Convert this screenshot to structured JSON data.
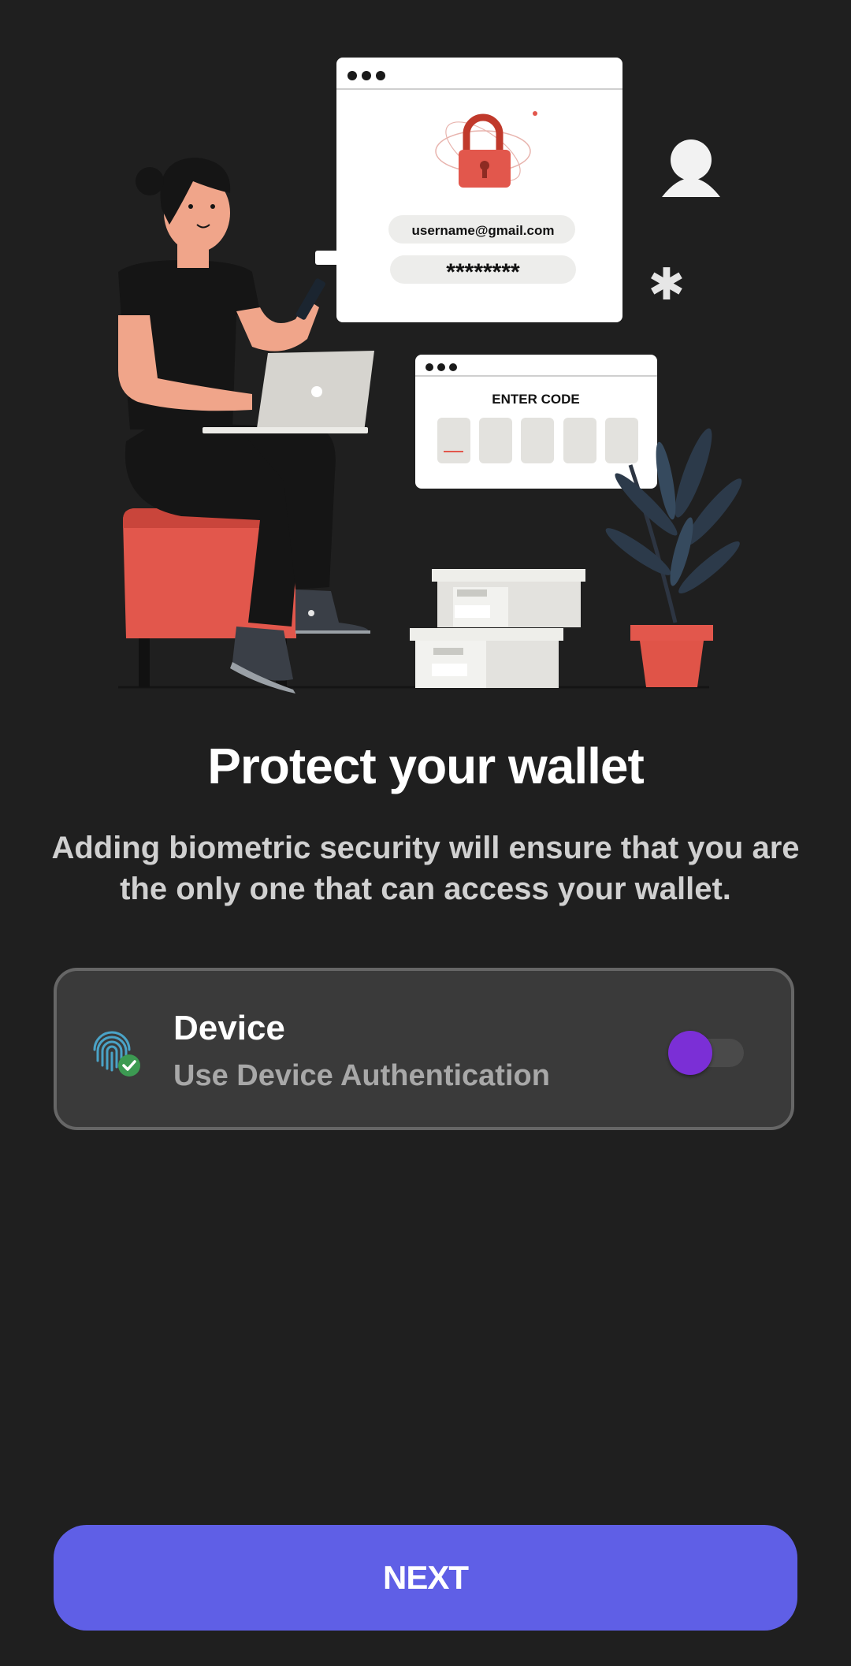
{
  "illustration": {
    "email_text": "username@gmail.com",
    "password_text": "********",
    "code_label": "ENTER CODE"
  },
  "title": "Protect your wallet",
  "subtitle": "Adding biometric security will ensure that you are the only one that can access your wallet.",
  "auth_option": {
    "title": "Device",
    "subtitle": "Use Device Authentication",
    "icon": "fingerprint-check-icon",
    "toggle_on": true,
    "toggle_color": "#7b2fd6"
  },
  "next_button": {
    "label": "NEXT",
    "color": "#5f5fe6"
  }
}
